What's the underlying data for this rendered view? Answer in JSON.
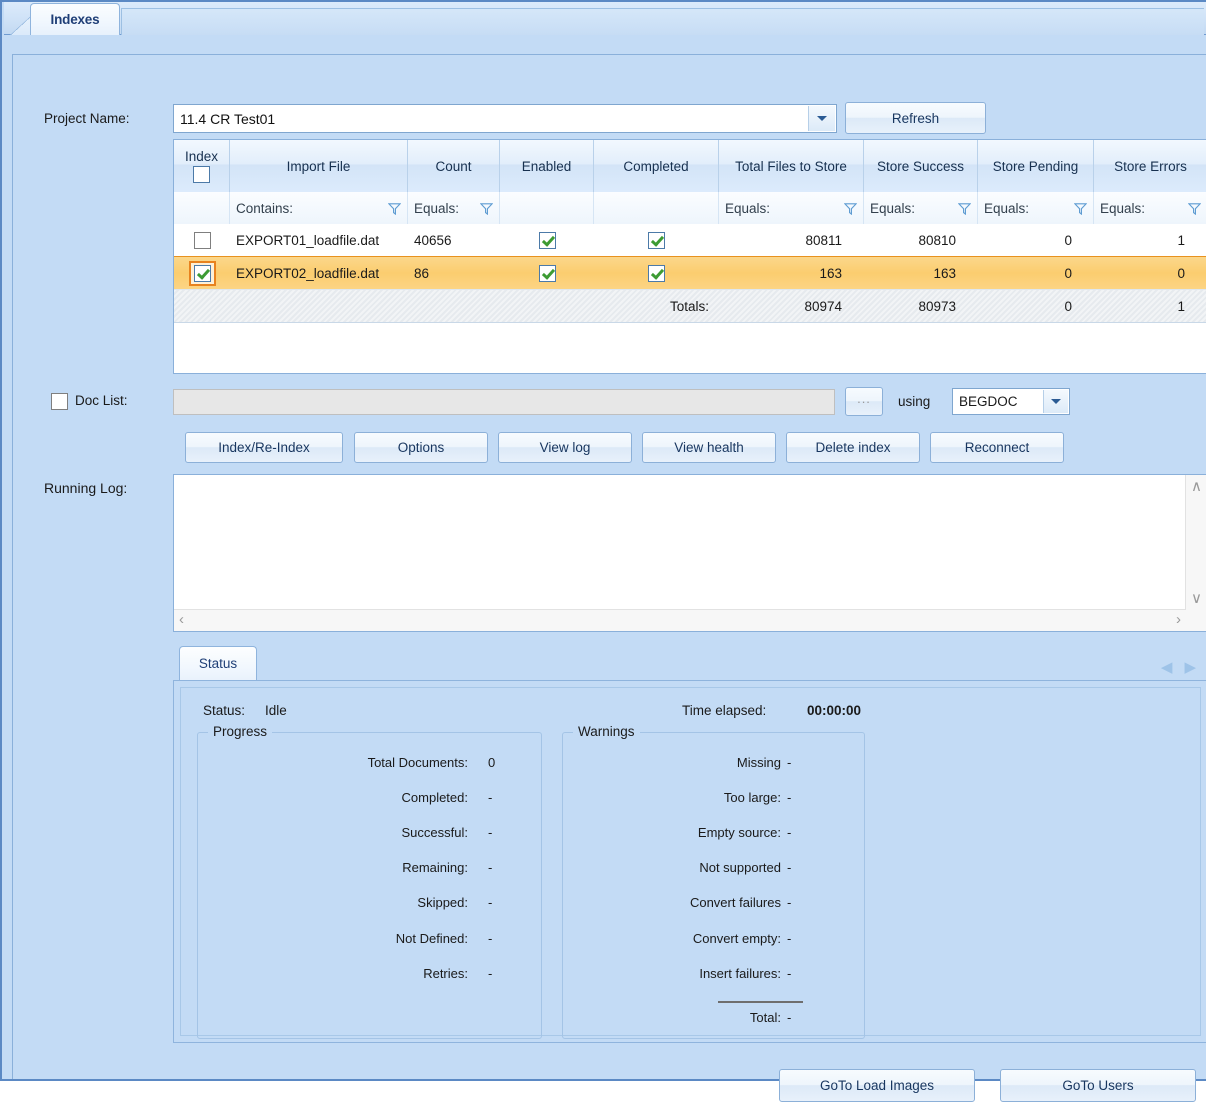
{
  "window": {
    "tabs": [
      {
        "label": "Indexes",
        "active": true
      }
    ]
  },
  "form": {
    "project_label": "Project Name:",
    "project_value": "11.4 CR Test01",
    "refresh_label": "Refresh",
    "doclist_label": "Doc List:",
    "doclist_value": "",
    "browse_label": "...",
    "using_label": "using",
    "using_value": "BEGDOC",
    "running_log_label": "Running Log:",
    "running_log_value": ""
  },
  "actions": {
    "index_reindex": "Index/Re-Index",
    "options": "Options",
    "view_log": "View log",
    "view_health": "View health",
    "delete_index": "Delete index",
    "reconnect": "Reconnect"
  },
  "grid": {
    "columns": [
      "Index",
      "Import File",
      "Count",
      "Enabled",
      "Completed",
      "Total Files to Store",
      "Store Success",
      "Store Pending",
      "Store Errors"
    ],
    "filters": [
      "",
      "Contains:",
      "Equals:",
      "",
      "",
      "Equals:",
      "Equals:",
      "Equals:",
      "Equals:"
    ],
    "rows": [
      {
        "index_checked": false,
        "selected": false,
        "import_file": "EXPORT01_loadfile.dat",
        "count": "40656",
        "enabled": true,
        "completed": true,
        "total_files_to_store": "80811",
        "store_success": "80810",
        "store_pending": "0",
        "store_errors": "1"
      },
      {
        "index_checked": true,
        "selected": true,
        "import_file": "EXPORT02_loadfile.dat",
        "count": "86",
        "enabled": true,
        "completed": true,
        "total_files_to_store": "163",
        "store_success": "163",
        "store_pending": "0",
        "store_errors": "0"
      }
    ],
    "totals": {
      "label": "Totals:",
      "total_files_to_store": "80974",
      "store_success": "80973",
      "store_pending": "0",
      "store_errors": "1"
    }
  },
  "status_panel": {
    "tab_label": "Status",
    "status_label": "Status:",
    "status_value": "Idle",
    "time_elapsed_label": "Time elapsed:",
    "time_elapsed_value": "00:00:00",
    "progress": {
      "title": "Progress",
      "items": [
        {
          "label": "Total Documents:",
          "value": "0"
        },
        {
          "label": "Completed:",
          "value": "-"
        },
        {
          "label": "Successful:",
          "value": "-"
        },
        {
          "label": "Remaining:",
          "value": "-"
        },
        {
          "label": "Skipped:",
          "value": "-"
        },
        {
          "label": "Not Defined:",
          "value": "-"
        },
        {
          "label": "Retries:",
          "value": "-"
        }
      ]
    },
    "warnings": {
      "title": "Warnings",
      "items": [
        {
          "label": "Missing",
          "value": "-"
        },
        {
          "label": "Too large:",
          "value": "-"
        },
        {
          "label": "Empty source:",
          "value": "-"
        },
        {
          "label": "Not supported",
          "value": "-"
        },
        {
          "label": "Convert failures",
          "value": "-"
        },
        {
          "label": "Convert empty:",
          "value": "-"
        },
        {
          "label": "Insert failures:",
          "value": "-"
        }
      ],
      "total_label": "Total:",
      "total_value": "-"
    }
  },
  "footer": {
    "goto_load_images": "GoTo Load Images",
    "goto_users": "GoTo Users"
  },
  "colors": {
    "chrome_blue": "#c3dbf5",
    "border_blue": "#5b89c4",
    "selected_row": "#fbcd6f",
    "selected_outline": "#e8821e",
    "check_green": "#3d9b33",
    "tab_text": "#1f3f77"
  }
}
